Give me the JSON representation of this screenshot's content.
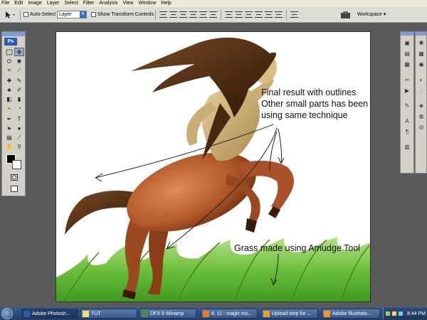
{
  "menu": [
    "File",
    "Edit",
    "Image",
    "Layer",
    "Select",
    "Filter",
    "Analysis",
    "View",
    "Window",
    "Help"
  ],
  "options": {
    "auto_select_label": "Auto-Select",
    "auto_select_value": "Layer",
    "transform_label": "Show Transform Controls"
  },
  "workspace_label": "Workspace ▾",
  "toolbox": {
    "logo": "Ps"
  },
  "annotations": {
    "line1": "Final result with outlines",
    "line2": "Other small parts has been made",
    "line3": "using same technique",
    "grass": "Grass made using Amudge Tool"
  },
  "taskbar": {
    "tasks": [
      "Adobe Photosh...",
      "TUT",
      "DFX 9 Winamp",
      "8. 11 - magic mo...",
      "Upload step for ...",
      "Adobe Illustrato..."
    ],
    "clock": "8:44 PM"
  },
  "colors": {
    "accent": "#2a5db0",
    "taskbar": "#2c4a78",
    "foreground": "#000000",
    "background": "#ffffff"
  }
}
